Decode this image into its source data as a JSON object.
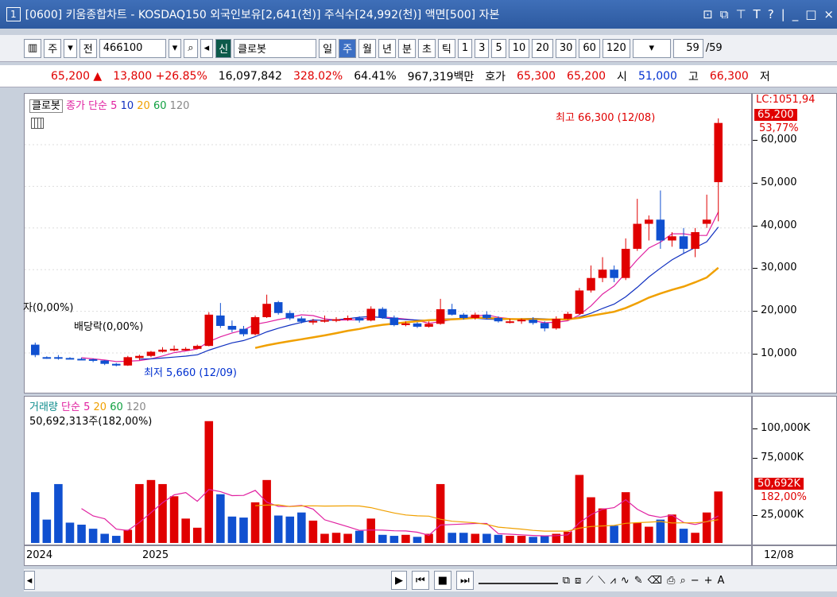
{
  "title": {
    "num": "1",
    "text": "[0600] 키움종합차트 - KOSDAQ150 외국인보유[2,641(천)] 주식수[24,992(천)] 액면[500] 자본"
  },
  "title_icons": [
    "restore-icon",
    "window-icon",
    "pin-icon",
    "T",
    "?",
    "|",
    "_",
    "□",
    "×"
  ],
  "toolbar": {
    "mode": "주",
    "jeon": "전",
    "code": "466100",
    "sin": "신",
    "name": "클로봇",
    "periods": [
      "일",
      "주",
      "월",
      "년"
    ],
    "period_selected": "주",
    "extra": [
      "분",
      "초",
      "틱"
    ],
    "nums": [
      "1",
      "3",
      "5",
      "10",
      "20",
      "30",
      "60",
      "120"
    ],
    "count": "59",
    "total": "/59"
  },
  "info": {
    "price": "65,200 ▲",
    "chg": "13,800 +26.85%",
    "volume": "16,097,842",
    "vol_ratio": "328.02%",
    "turnover": "64.41%",
    "amount": "967,319백만",
    "hoga_label": "호가",
    "ask": "65,300",
    "bid": "65,200",
    "open_label": "시",
    "open": "51,000",
    "high_label": "고",
    "high": "66,300",
    "low_label": "저"
  },
  "main": {
    "legend_name": "클로봇",
    "legend_ma": "종가 단순",
    "ma": [
      "5",
      "10",
      "20",
      "60",
      "120"
    ],
    "high_label": "최고 66,300 (12/08)",
    "low_label": "최저 5,660 (12/09)",
    "div1": "자(0,00%)",
    "div2": "배당락(0,00%)"
  },
  "axis": {
    "lc": "LC:1051,94",
    "price_flag": "65,200",
    "pct": "53,77%",
    "ticks": [
      "60,000",
      "50,000",
      "40,000",
      "30,000",
      "20,000",
      "10,000"
    ]
  },
  "vol": {
    "legend": "거래량",
    "ma_label": "단순",
    "ma": [
      "5",
      "20",
      "60",
      "120"
    ],
    "current": "50,692,313주(182,00%)"
  },
  "vaxis": {
    "ticks": [
      "100,000K",
      "75,000K",
      "25,000K"
    ],
    "flag": "50,692K",
    "pct": "182,00%"
  },
  "dates": {
    "y2024": "2024",
    "y2025": "2025",
    "last": "12/08"
  },
  "colors": {
    "up": "#e00000",
    "down": "#1050d0",
    "ma5": "#e020a0",
    "ma10": "#1030c0",
    "ma20": "#f0a000"
  },
  "chart_data": {
    "type": "candlestick",
    "x_start": "2024-W31",
    "x_end": "2025-W50",
    "ylim": [
      2000,
      68000
    ],
    "candles": [
      [
        12000,
        9500,
        12500,
        9000
      ],
      [
        9000,
        8800,
        9200,
        8600
      ],
      [
        9000,
        8800,
        9500,
        8400
      ],
      [
        8800,
        8700,
        9000,
        8500
      ],
      [
        8600,
        8500,
        8900,
        8300
      ],
      [
        8500,
        8200,
        8700,
        7800
      ],
      [
        8200,
        7400,
        8300,
        7100
      ],
      [
        7400,
        7000,
        7600,
        6800
      ],
      [
        7000,
        9000,
        9300,
        6900
      ],
      [
        8800,
        9300,
        9600,
        8300
      ],
      [
        9300,
        10300,
        10500,
        9000
      ],
      [
        10300,
        10800,
        11400,
        10100
      ],
      [
        10800,
        11000,
        11800,
        10400
      ],
      [
        11000,
        11000,
        11400,
        10600
      ],
      [
        11000,
        11700,
        12000,
        10900
      ],
      [
        11700,
        19200,
        19800,
        11600
      ],
      [
        19000,
        16500,
        22000,
        16000
      ],
      [
        16500,
        15600,
        17800,
        15000
      ],
      [
        15800,
        14500,
        16500,
        14000
      ],
      [
        14500,
        18600,
        19000,
        14200
      ],
      [
        18600,
        21800,
        24000,
        18400
      ],
      [
        22200,
        19600,
        22500,
        19200
      ],
      [
        19600,
        18300,
        20200,
        17900
      ],
      [
        18300,
        17500,
        18800,
        17100
      ],
      [
        17500,
        17700,
        18200,
        16800
      ],
      [
        17700,
        17900,
        19000,
        17300
      ],
      [
        17900,
        18100,
        18600,
        17400
      ],
      [
        18100,
        18400,
        19000,
        17700
      ],
      [
        18400,
        17800,
        18800,
        17300
      ],
      [
        17800,
        20600,
        21200,
        17600
      ],
      [
        20600,
        18500,
        21000,
        18200
      ],
      [
        18500,
        16700,
        19000,
        16400
      ],
      [
        16700,
        17100,
        17600,
        16400
      ],
      [
        17100,
        16300,
        17400,
        16000
      ],
      [
        16300,
        17000,
        17600,
        16100
      ],
      [
        17000,
        20500,
        23000,
        16800
      ],
      [
        20500,
        19200,
        21800,
        19000
      ],
      [
        19200,
        18400,
        19600,
        18000
      ],
      [
        18400,
        19200,
        19700,
        18000
      ],
      [
        19200,
        18400,
        20000,
        18000
      ],
      [
        18400,
        17600,
        18800,
        17300
      ],
      [
        17600,
        17600,
        18200,
        17100
      ],
      [
        17600,
        18000,
        18300,
        17000
      ],
      [
        18000,
        17200,
        18600,
        16800
      ],
      [
        17200,
        15900,
        17600,
        15200
      ],
      [
        15900,
        18200,
        18800,
        15600
      ],
      [
        18200,
        19400,
        19900,
        18000
      ],
      [
        19400,
        25000,
        25600,
        19200
      ],
      [
        25000,
        28000,
        31000,
        24500
      ],
      [
        28000,
        30000,
        33000,
        27000
      ],
      [
        30000,
        28000,
        31000,
        27000
      ],
      [
        28000,
        35000,
        37500,
        27500
      ],
      [
        35000,
        41000,
        47000,
        34500
      ],
      [
        41000,
        42000,
        43000,
        37000
      ],
      [
        42000,
        37000,
        49000,
        35000
      ],
      [
        37000,
        38000,
        39000,
        35500
      ],
      [
        38000,
        35000,
        40000,
        34000
      ],
      [
        35000,
        39000,
        40000,
        33000
      ],
      [
        41000,
        42000,
        48000,
        40000
      ],
      [
        51000,
        65200,
        66300,
        41600
      ]
    ],
    "volume_k": [
      50000,
      23000,
      58000,
      20000,
      18000,
      14000,
      9000,
      7000,
      13000,
      58000,
      62000,
      58000,
      46000,
      24000,
      15000,
      120000,
      48000,
      26000,
      25000,
      40000,
      62000,
      27000,
      26000,
      30000,
      22000,
      9000,
      10000,
      9000,
      12000,
      24000,
      8000,
      7000,
      8000,
      6000,
      9000,
      58000,
      10000,
      10000,
      9000,
      9000,
      8000,
      7000,
      7000,
      6000,
      7000,
      9000,
      11000,
      67000,
      45000,
      34000,
      17000,
      50000,
      20000,
      16000,
      23000,
      28000,
      14000,
      10000,
      30000,
      50692
    ]
  }
}
